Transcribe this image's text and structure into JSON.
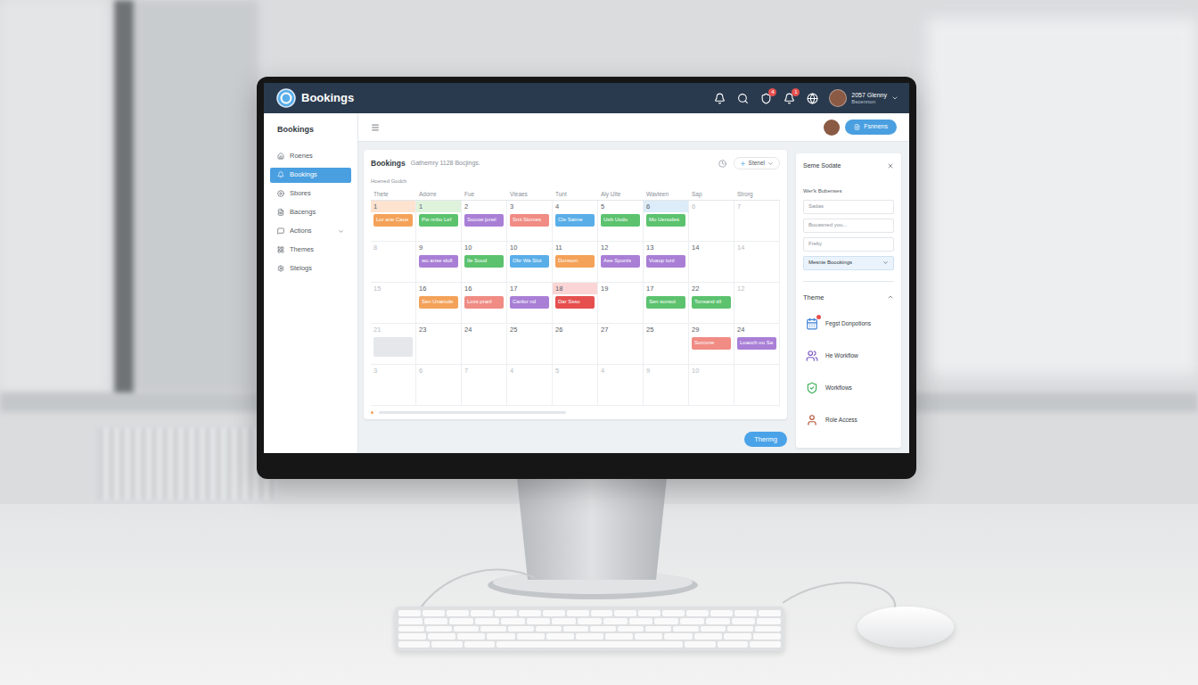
{
  "topbar": {
    "app_name": "Bookings",
    "icons": [
      {
        "badge": null
      },
      {
        "badge": null
      },
      {
        "badge": "4"
      },
      {
        "badge": "1"
      },
      {
        "badge": null
      }
    ],
    "user": {
      "name": "2057 Glenny",
      "role": "Bscennon"
    }
  },
  "subheader": {
    "button": "Fsnnens"
  },
  "sidebar": {
    "title": "Bookings",
    "items": [
      {
        "label": "Roenes",
        "selected": false,
        "expandable": false
      },
      {
        "label": "Bookings",
        "selected": true,
        "expandable": false
      },
      {
        "label": "Sbores",
        "selected": false,
        "expandable": false
      },
      {
        "label": "Bacengs",
        "selected": false,
        "expandable": false
      },
      {
        "label": "Actions",
        "selected": false,
        "expandable": true
      },
      {
        "label": "Themes",
        "selected": false,
        "expandable": false
      },
      {
        "label": "Stelogs",
        "selected": false,
        "expandable": false
      }
    ]
  },
  "calendar": {
    "title": "Bookings",
    "subtitle": "Gathemry 1128 Bocjings.",
    "filter": "Stenel",
    "section": "Hoened Godch",
    "columns": [
      "Thete",
      "Adorre",
      "Fue",
      "Vleaes",
      "Tunt",
      "Aly Uite",
      "Wavleen",
      "Sap",
      "Strorg"
    ],
    "weeks": [
      [
        {
          "day": "1",
          "muted": false,
          "highlight": "#fde3d0",
          "events": [
            {
              "kind": "event",
              "text": "Lor ane Caoe",
              "color": "#f4a259"
            }
          ]
        },
        {
          "day": "1",
          "muted": false,
          "highlight": "#dff3dc",
          "events": [
            {
              "kind": "event",
              "text": "Pw nnbo Lef",
              "color": "#5cc26e"
            }
          ]
        },
        {
          "day": "2",
          "muted": false,
          "highlight": null,
          "events": [
            {
              "kind": "event",
              "text": "Sooow jonel",
              "color": "#a97fd6"
            }
          ]
        },
        {
          "day": "3",
          "muted": false,
          "highlight": null,
          "events": [
            {
              "kind": "event",
              "text": "Smi Siomes",
              "color": "#f08c84"
            }
          ]
        },
        {
          "day": "4",
          "muted": false,
          "highlight": null,
          "events": [
            {
              "kind": "event",
              "text": "Cle Saime",
              "color": "#5aaee8"
            }
          ]
        },
        {
          "day": "5",
          "muted": false,
          "highlight": null,
          "events": [
            {
              "kind": "event",
              "text": "Ueb Uodo",
              "color": "#5cc26e"
            }
          ]
        },
        {
          "day": "6",
          "muted": false,
          "highlight": "#dcecf8",
          "events": [
            {
              "kind": "event",
              "text": "Mo Uenodes",
              "color": "#5cc26e"
            }
          ]
        },
        {
          "day": "6",
          "muted": true,
          "highlight": null,
          "events": []
        },
        {
          "day": "7",
          "muted": true,
          "highlight": null,
          "events": []
        }
      ],
      [
        {
          "day": "8",
          "muted": true,
          "highlight": null,
          "events": []
        },
        {
          "day": "9",
          "muted": false,
          "highlight": null,
          "events": [
            {
              "kind": "event",
              "text": "wu anse sloll",
              "color": "#a97fd6"
            }
          ]
        },
        {
          "day": "10",
          "muted": false,
          "highlight": null,
          "events": [
            {
              "kind": "event",
              "text": "Ile Soud",
              "color": "#5cc26e"
            }
          ]
        },
        {
          "day": "10",
          "muted": false,
          "highlight": null,
          "events": [
            {
              "kind": "event",
              "text": "Obr Wa Slot",
              "color": "#5aaee8"
            }
          ]
        },
        {
          "day": "11",
          "muted": false,
          "highlight": null,
          "events": [
            {
              "kind": "event",
              "text": "Donsom",
              "color": "#f4a259"
            }
          ]
        },
        {
          "day": "12",
          "muted": false,
          "highlight": null,
          "events": [
            {
              "kind": "event",
              "text": "Aee Sponts",
              "color": "#a97fd6"
            }
          ]
        },
        {
          "day": "13",
          "muted": false,
          "highlight": null,
          "events": [
            {
              "kind": "event",
              "text": "Vuaop tonl",
              "color": "#a97fd6"
            }
          ]
        },
        {
          "day": "14",
          "muted": false,
          "highlight": null,
          "events": []
        },
        {
          "day": "14",
          "muted": true,
          "highlight": null,
          "events": []
        }
      ],
      [
        {
          "day": "15",
          "muted": true,
          "highlight": null,
          "events": []
        },
        {
          "day": "16",
          "muted": false,
          "highlight": null,
          "events": [
            {
              "kind": "event",
              "text": "Sen Unarode",
              "color": "#f4a259"
            }
          ]
        },
        {
          "day": "16",
          "muted": false,
          "highlight": null,
          "events": [
            {
              "kind": "event",
              "text": "Loxs pranl",
              "color": "#f08c84"
            }
          ]
        },
        {
          "day": "17",
          "muted": false,
          "highlight": null,
          "events": [
            {
              "kind": "event",
              "text": "Canlor nd",
              "color": "#a97fd6"
            }
          ]
        },
        {
          "day": "18",
          "muted": false,
          "highlight": "#fbd5d5",
          "events": [
            {
              "kind": "event",
              "text": "Dar Ssso",
              "color": "#e5504f"
            }
          ]
        },
        {
          "day": "19",
          "muted": false,
          "highlight": null,
          "events": []
        },
        {
          "day": "17",
          "muted": false,
          "highlight": null,
          "events": [
            {
              "kind": "event",
              "text": "Sen sonsot",
              "color": "#5cc26e"
            }
          ]
        },
        {
          "day": "22",
          "muted": false,
          "highlight": null,
          "events": [
            {
              "kind": "event",
              "text": "Tonsand sll",
              "color": "#5cc26e"
            }
          ]
        },
        {
          "day": "12",
          "muted": true,
          "highlight": null,
          "events": []
        }
      ],
      [
        {
          "day": "21",
          "muted": true,
          "highlight": null,
          "events": [
            {
              "kind": "placeholder"
            }
          ]
        },
        {
          "day": "23",
          "muted": false,
          "highlight": null,
          "events": []
        },
        {
          "day": "24",
          "muted": false,
          "highlight": null,
          "events": []
        },
        {
          "day": "25",
          "muted": false,
          "highlight": null,
          "events": []
        },
        {
          "day": "26",
          "muted": false,
          "highlight": null,
          "events": []
        },
        {
          "day": "27",
          "muted": false,
          "highlight": null,
          "events": []
        },
        {
          "day": "25",
          "muted": false,
          "highlight": null,
          "events": []
        },
        {
          "day": "29",
          "muted": false,
          "highlight": null,
          "events": [
            {
              "kind": "event",
              "text": "Sorcone",
              "color": "#f08c84"
            }
          ]
        },
        {
          "day": "24",
          "muted": false,
          "highlight": null,
          "events": [
            {
              "kind": "event",
              "text": "Loaoch oo Sa",
              "color": "#a97fd6"
            }
          ]
        }
      ],
      [
        {
          "day": "3",
          "muted": true,
          "highlight": null,
          "events": []
        },
        {
          "day": "6",
          "muted": true,
          "highlight": null,
          "events": []
        },
        {
          "day": "7",
          "muted": true,
          "highlight": null,
          "events": []
        },
        {
          "day": "4",
          "muted": true,
          "highlight": null,
          "events": []
        },
        {
          "day": "5",
          "muted": true,
          "highlight": null,
          "events": []
        },
        {
          "day": "4",
          "muted": true,
          "highlight": null,
          "events": []
        },
        {
          "day": "9",
          "muted": true,
          "highlight": null,
          "events": []
        },
        {
          "day": "10",
          "muted": true,
          "highlight": null,
          "events": []
        },
        {
          "day": "",
          "muted": true,
          "highlight": null,
          "events": []
        }
      ]
    ]
  },
  "panel": {
    "title": "Seme Sodate",
    "subtitle": "Wer'k Bubenses",
    "fields": [
      {
        "kind": "input",
        "value": "Sadas"
      },
      {
        "kind": "input",
        "value": "Booasned you..."
      },
      {
        "kind": "input",
        "value": "Frelty"
      },
      {
        "kind": "select",
        "value": "Mesnie Boookings"
      }
    ],
    "theme": {
      "title": "Theme",
      "expanded": true,
      "items": [
        {
          "label": "Fegst Donpotions",
          "badge": true
        },
        {
          "label": "He Workflow",
          "badge": false
        },
        {
          "label": "Workflows",
          "badge": false
        },
        {
          "label": "Role Access",
          "badge": false
        }
      ]
    }
  },
  "footer_button": "Thermg"
}
